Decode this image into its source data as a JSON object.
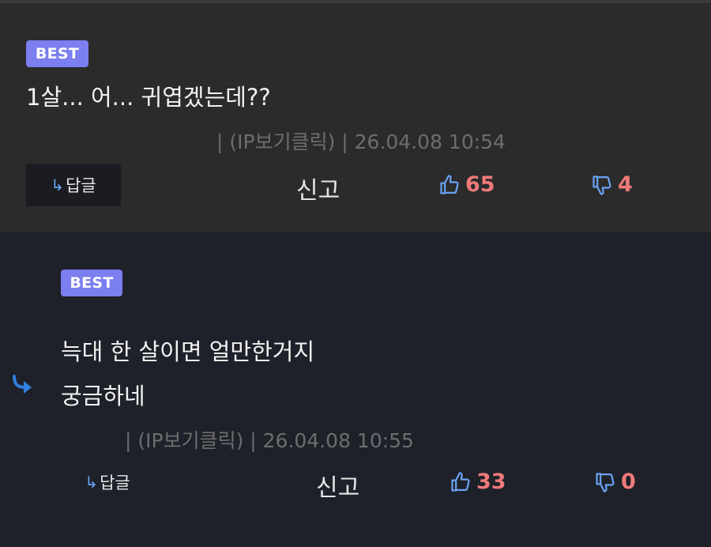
{
  "colors": {
    "badge": "#7b7ff0",
    "count": "#ee7a7a",
    "thumb_icon": "#6aa2f2",
    "reply_arrow": "#2f7fde"
  },
  "comments": [
    {
      "badge": "BEST",
      "lines": [
        "1살... 어... 귀엽겠는데??"
      ],
      "meta": "| (IP보기클릭) | 26.04.08 10:54",
      "reply_label": "답글",
      "report_label": "신고",
      "likes": "65",
      "dislikes": "4"
    },
    {
      "badge": "BEST",
      "lines": [
        "늑대 한 살이면 얼만한거지",
        "궁금하네"
      ],
      "meta": "| (IP보기클릭) | 26.04.08 10:55",
      "reply_label": "답글",
      "report_label": "신고",
      "likes": "33",
      "dislikes": "0"
    }
  ],
  "icons": {
    "reply_arrow": "corner-down-right-arrow-icon",
    "thumbs_up": "thumbs-up-icon",
    "thumbs_down": "thumbs-down-icon",
    "nested_reply": "nested-reply-arrow-icon"
  }
}
